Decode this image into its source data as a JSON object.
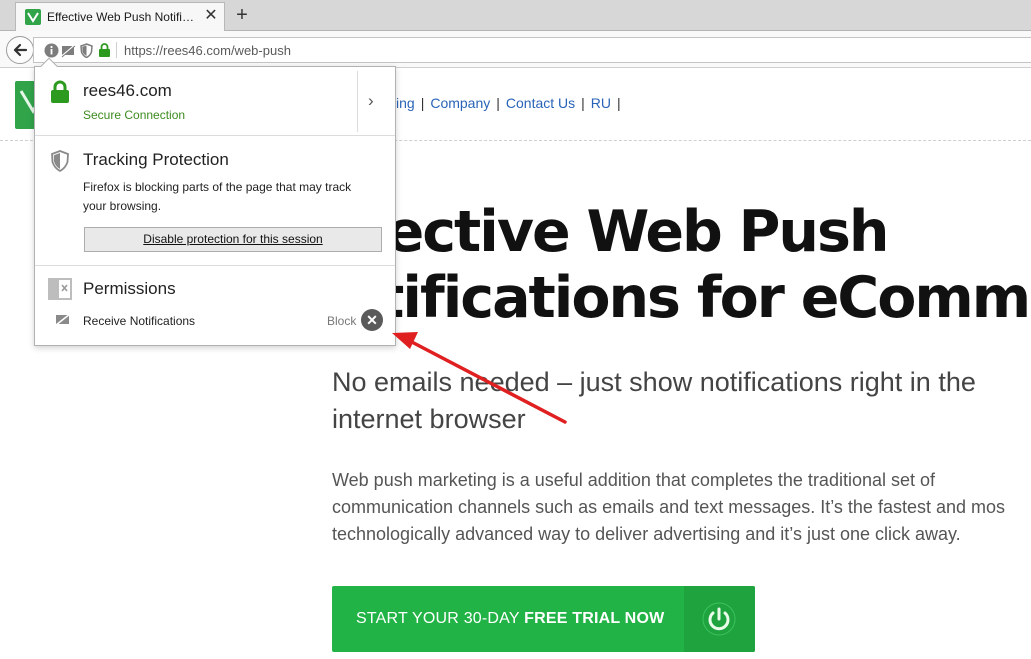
{
  "browser": {
    "tab": {
      "title": "Effective Web Push Notifi…",
      "close_glyph": "✕"
    },
    "new_tab_glyph": "+",
    "url": "https://rees46.com/web-push"
  },
  "site": {
    "nav": [
      "ing",
      "Company",
      "Contact Us",
      "RU"
    ],
    "nav_separator": "|",
    "hero_line1": "ffective Web Push",
    "hero_line2": "otifications for eCommerce",
    "subtitle": "No emails needed – just show notifications right in the internet browser",
    "body_line1": "Web push marketing is a useful addition that completes the traditional set of",
    "body_line2": "communication channels such as emails and text messages. It’s the fastest and mos",
    "body_line3": "technologically advanced way to deliver advertising and it’s just one click away.",
    "cta_prefix": "START YOUR 30-DAY ",
    "cta_bold": "FREE TRIAL NOW"
  },
  "panel": {
    "host": "rees46.com",
    "secure_label": "Secure Connection",
    "more_glyph": "›",
    "tracking_title": "Tracking Protection",
    "tracking_desc": "Firefox is blocking parts of the page that may track your browsing.",
    "tracking_button": "Disable protection for this session",
    "permissions_title": "Permissions",
    "notification_label": "Receive Notifications",
    "notification_state": "Block",
    "remove_glyph": "✕"
  },
  "colors": {
    "brand_green": "#21b345",
    "secure_green": "#3d8b1f",
    "link_blue": "#2a64b8",
    "annotation_red": "#e02020"
  },
  "icons": [
    "back-arrow-icon",
    "info-icon",
    "notification-icon",
    "shield-icon",
    "lock-icon",
    "power-icon",
    "permissions-icon",
    "chevron-right-icon",
    "close-icon"
  ]
}
